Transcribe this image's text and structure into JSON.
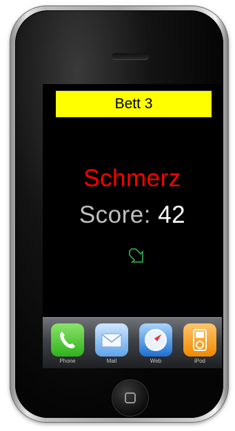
{
  "bed": {
    "label": "Bett 3"
  },
  "alert": {
    "name": "Schmerz"
  },
  "score": {
    "label": "Score: ",
    "value": "42"
  },
  "trend": {
    "icon": "arrow-down-right-icon",
    "color": "#2ca24b"
  },
  "dock": {
    "apps": [
      {
        "label": "Phone",
        "icon": "phone-icon"
      },
      {
        "label": "Mail",
        "icon": "mail-icon"
      },
      {
        "label": "Web",
        "icon": "safari-icon"
      },
      {
        "label": "iPod",
        "icon": "ipod-icon"
      }
    ]
  },
  "colors": {
    "bed_bar": "#ffff00",
    "alert": "#ff0000",
    "score_label": "#bfbfbf",
    "score_value": "#ffffff"
  }
}
